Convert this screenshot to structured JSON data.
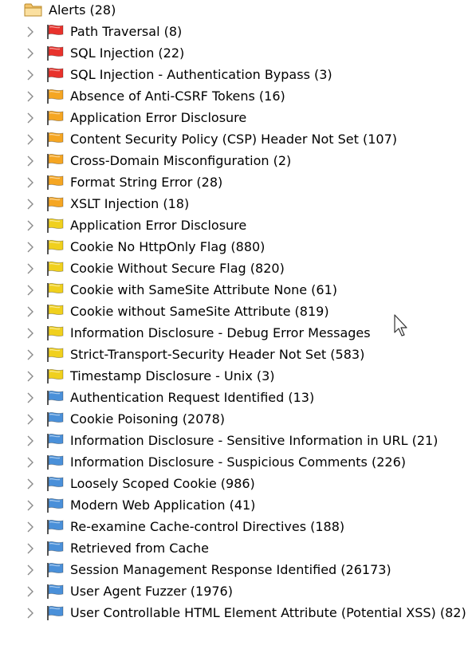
{
  "tree": {
    "root": {
      "label": "Alerts (28)",
      "icon": "folder-icon"
    },
    "colors": {
      "high": "#e8322c",
      "medium": "#f5a623",
      "low": "#f0d01e",
      "informational": "#4a90d9"
    },
    "items": [
      {
        "label": "Path Traversal (8)",
        "risk": "high"
      },
      {
        "label": "SQL Injection (22)",
        "risk": "high"
      },
      {
        "label": "SQL Injection - Authentication Bypass (3)",
        "risk": "high"
      },
      {
        "label": "Absence of Anti-CSRF Tokens (16)",
        "risk": "medium"
      },
      {
        "label": "Application Error Disclosure",
        "risk": "medium"
      },
      {
        "label": "Content Security Policy (CSP) Header Not Set (107)",
        "risk": "medium"
      },
      {
        "label": "Cross-Domain Misconfiguration (2)",
        "risk": "medium"
      },
      {
        "label": "Format String Error (28)",
        "risk": "medium"
      },
      {
        "label": "XSLT Injection (18)",
        "risk": "medium"
      },
      {
        "label": "Application Error Disclosure",
        "risk": "low"
      },
      {
        "label": "Cookie No HttpOnly Flag (880)",
        "risk": "low"
      },
      {
        "label": "Cookie Without Secure Flag (820)",
        "risk": "low"
      },
      {
        "label": "Cookie with SameSite Attribute None (61)",
        "risk": "low"
      },
      {
        "label": "Cookie without SameSite Attribute (819)",
        "risk": "low"
      },
      {
        "label": "Information Disclosure - Debug Error Messages",
        "risk": "low"
      },
      {
        "label": "Strict-Transport-Security Header Not Set (583)",
        "risk": "low"
      },
      {
        "label": "Timestamp Disclosure - Unix (3)",
        "risk": "low"
      },
      {
        "label": "Authentication Request Identified (13)",
        "risk": "informational"
      },
      {
        "label": "Cookie Poisoning (2078)",
        "risk": "informational"
      },
      {
        "label": "Information Disclosure - Sensitive Information in URL (21)",
        "risk": "informational"
      },
      {
        "label": "Information Disclosure - Suspicious Comments (226)",
        "risk": "informational"
      },
      {
        "label": "Loosely Scoped Cookie (986)",
        "risk": "informational"
      },
      {
        "label": "Modern Web Application (41)",
        "risk": "informational"
      },
      {
        "label": "Re-examine Cache-control Directives (188)",
        "risk": "informational"
      },
      {
        "label": "Retrieved from Cache",
        "risk": "informational"
      },
      {
        "label": "Session Management Response Identified (26173)",
        "risk": "informational"
      },
      {
        "label": "User Agent Fuzzer (1976)",
        "risk": "informational"
      },
      {
        "label": "User Controllable HTML Element Attribute (Potential XSS) (82)",
        "risk": "informational"
      }
    ]
  }
}
